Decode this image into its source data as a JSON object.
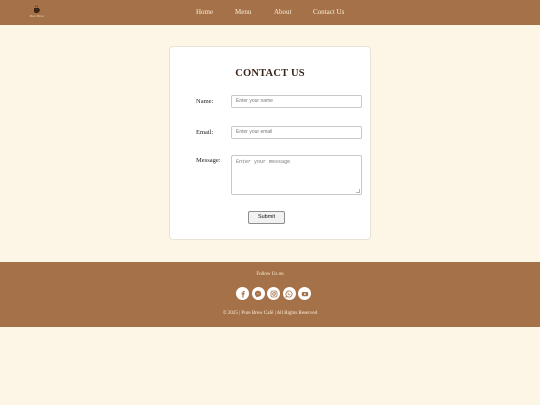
{
  "brand": {
    "logo_text": "Pure Brew",
    "logo_icon": "coffee-cup-icon"
  },
  "nav": {
    "items": [
      {
        "label": "Home"
      },
      {
        "label": "Menu"
      },
      {
        "label": "About"
      },
      {
        "label": "Contact Us"
      }
    ]
  },
  "contact": {
    "title": "CONTACT US",
    "name_label": "Name:",
    "name_placeholder": "Enter your name",
    "email_label": "Email:",
    "email_placeholder": "Enter your email",
    "message_label": "Message:",
    "message_placeholder": "Enter your message",
    "submit_label": "Submit"
  },
  "footer": {
    "follow_text": "Follow Us on",
    "socials": [
      "facebook-icon",
      "messenger-icon",
      "instagram-icon",
      "whatsapp-icon",
      "youtube-icon"
    ],
    "copyright": "© 2025 | Pure Brew Café | All Rights Reserved"
  },
  "colors": {
    "brand_brown": "#a57149",
    "background": "#fdf6e6",
    "title": "#3b2418"
  }
}
